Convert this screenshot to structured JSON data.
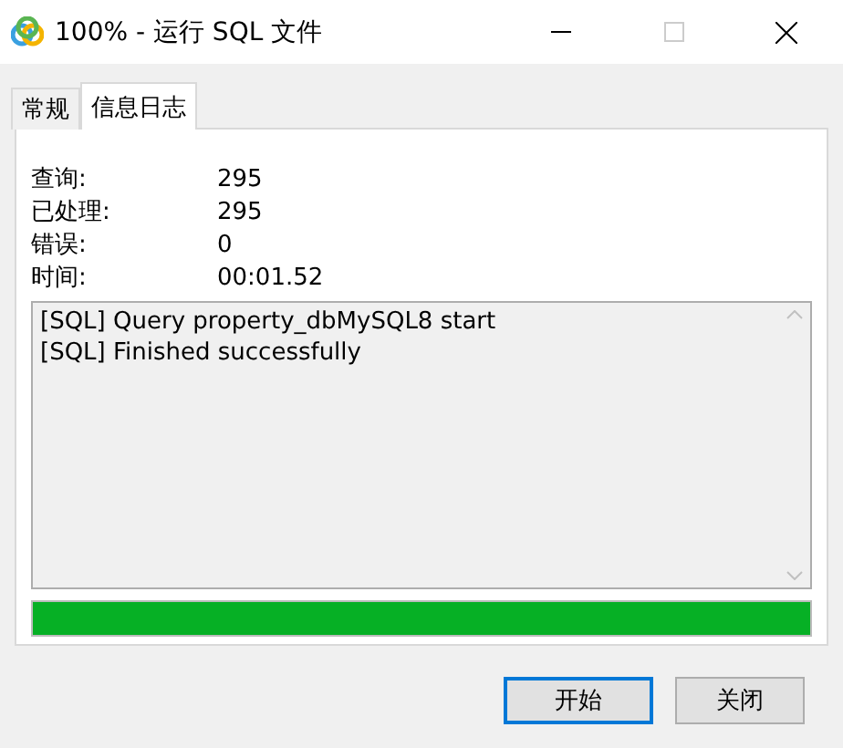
{
  "window": {
    "title": "100% - 运行 SQL 文件"
  },
  "tabs": [
    {
      "label": "常规",
      "selected": false
    },
    {
      "label": "信息日志",
      "selected": true
    }
  ],
  "stats": [
    {
      "label": "查询:",
      "value": "295"
    },
    {
      "label": "已处理:",
      "value": "295"
    },
    {
      "label": "错误:",
      "value": "0"
    },
    {
      "label": "时间:",
      "value": "00:01.52"
    }
  ],
  "log": [
    "[SQL] Query property_dbMySQL8 start",
    "[SQL] Finished successfully"
  ],
  "progress": {
    "level": 1
  },
  "buttons": [
    {
      "label": "开始",
      "focused": true
    },
    {
      "label": "关闭",
      "focused": false
    }
  ]
}
